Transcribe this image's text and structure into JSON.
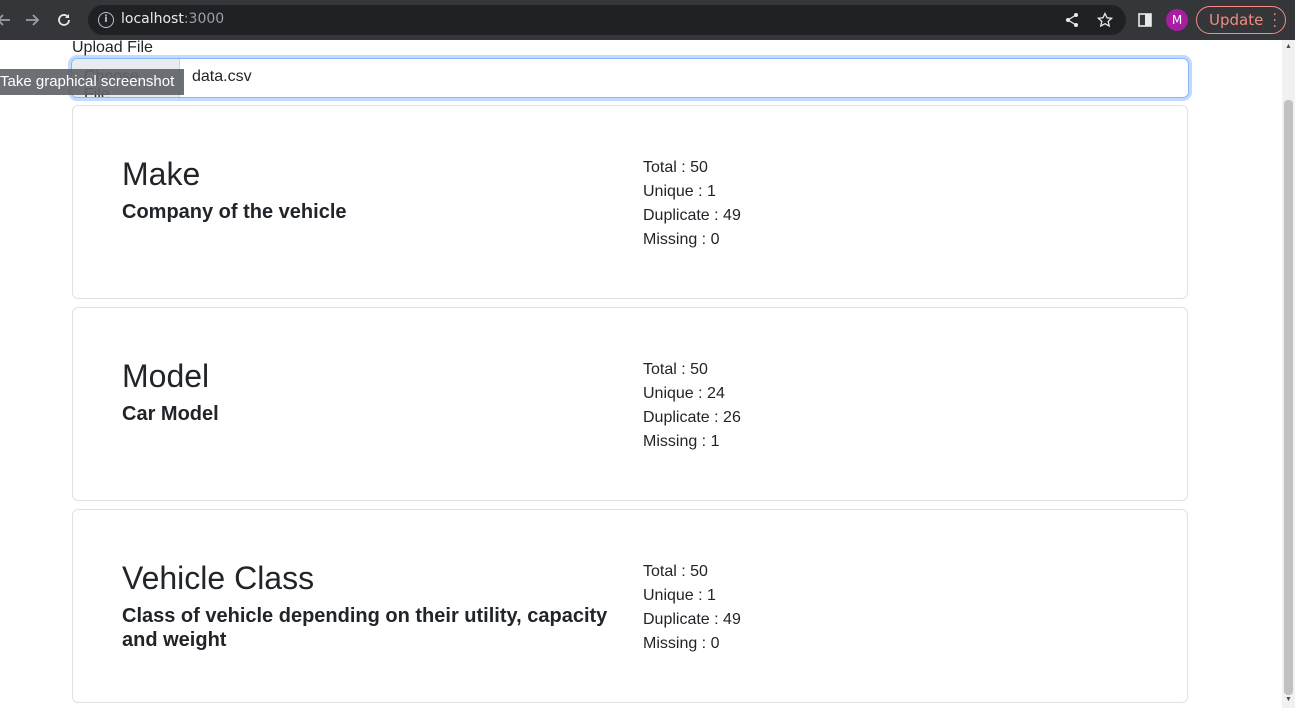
{
  "browser": {
    "url_host": "localhost",
    "url_port": ":3000",
    "profile_initial": "M",
    "update_label": "Update"
  },
  "upload": {
    "label": "Upload File",
    "choose_label": "Choose File",
    "file_name": "data.csv",
    "tooltip": "Take graphical screenshot"
  },
  "cards": [
    {
      "title": "Make",
      "description": "Company of the vehicle",
      "total": "Total : 50",
      "unique": "Unique : 1",
      "duplicate": "Duplicate : 49",
      "missing": "Missing : 0"
    },
    {
      "title": "Model",
      "description": "Car Model",
      "total": "Total : 50",
      "unique": "Unique : 24",
      "duplicate": "Duplicate : 26",
      "missing": "Missing : 1"
    },
    {
      "title": "Vehicle Class",
      "description": "Class of vehicle depending on their utility, capacity and weight",
      "total": "Total : 50",
      "unique": "Unique : 1",
      "duplicate": "Duplicate : 49",
      "missing": "Missing : 0"
    }
  ]
}
